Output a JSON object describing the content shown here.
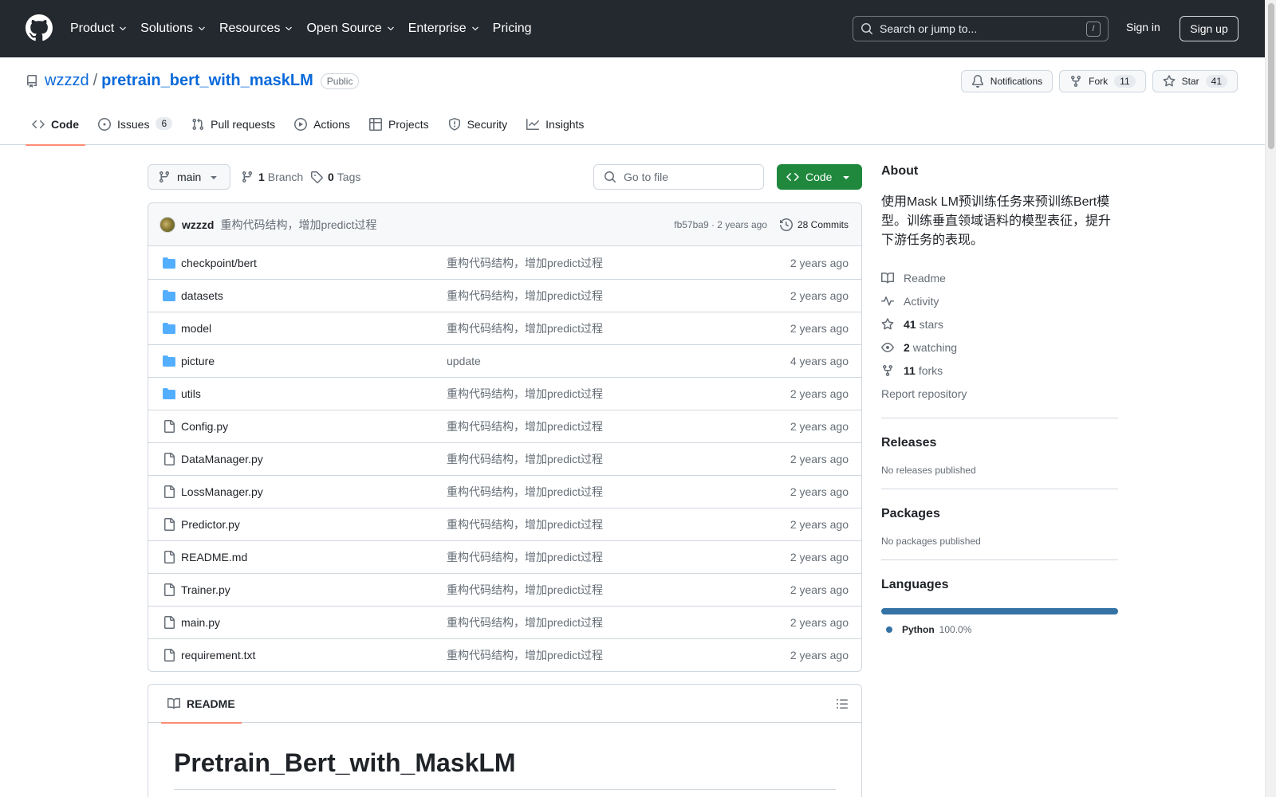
{
  "header": {
    "nav": [
      {
        "label": "Product",
        "dropdown": true
      },
      {
        "label": "Solutions",
        "dropdown": true
      },
      {
        "label": "Resources",
        "dropdown": true
      },
      {
        "label": "Open Source",
        "dropdown": true
      },
      {
        "label": "Enterprise",
        "dropdown": true
      },
      {
        "label": "Pricing",
        "dropdown": false
      }
    ],
    "search_placeholder": "Search or jump to...",
    "search_shortcut": "/",
    "sign_in": "Sign in",
    "sign_up": "Sign up"
  },
  "repo": {
    "owner": "wzzzd",
    "separator": "/",
    "name": "pretrain_bert_with_maskLM",
    "visibility": "Public",
    "notifications_label": "Notifications",
    "fork_label": "Fork",
    "fork_count": "11",
    "star_label": "Star",
    "star_count": "41"
  },
  "tabs": [
    {
      "label": "Code",
      "icon": "code-icon",
      "active": true,
      "count": ""
    },
    {
      "label": "Issues",
      "icon": "issue-opened-icon",
      "active": false,
      "count": "6"
    },
    {
      "label": "Pull requests",
      "icon": "git-pull-request-icon",
      "active": false,
      "count": ""
    },
    {
      "label": "Actions",
      "icon": "play-icon",
      "active": false,
      "count": ""
    },
    {
      "label": "Projects",
      "icon": "table-icon",
      "active": false,
      "count": ""
    },
    {
      "label": "Security",
      "icon": "shield-icon",
      "active": false,
      "count": ""
    },
    {
      "label": "Insights",
      "icon": "graph-icon",
      "active": false,
      "count": ""
    }
  ],
  "toolbar": {
    "branch": "main",
    "branch_count": "1",
    "branch_label": "Branch",
    "tag_count": "0",
    "tag_label": "Tags",
    "goto_placeholder": "Go to file",
    "code_button": "Code"
  },
  "latest_commit": {
    "author": "wzzzd",
    "message": "重构代码结构，增加predict过程",
    "hash_age": "fb57ba9 · 2 years ago",
    "commits": "28 Commits"
  },
  "files": [
    {
      "type": "dir",
      "name": "checkpoint/bert",
      "message": "重构代码结构，增加predict过程",
      "age": "2 years ago"
    },
    {
      "type": "dir",
      "name": "datasets",
      "message": "重构代码结构，增加predict过程",
      "age": "2 years ago"
    },
    {
      "type": "dir",
      "name": "model",
      "message": "重构代码结构，增加predict过程",
      "age": "2 years ago"
    },
    {
      "type": "dir",
      "name": "picture",
      "message": "update",
      "age": "4 years ago"
    },
    {
      "type": "dir",
      "name": "utils",
      "message": "重构代码结构，增加predict过程",
      "age": "2 years ago"
    },
    {
      "type": "file",
      "name": "Config.py",
      "message": "重构代码结构，增加predict过程",
      "age": "2 years ago"
    },
    {
      "type": "file",
      "name": "DataManager.py",
      "message": "重构代码结构，增加predict过程",
      "age": "2 years ago"
    },
    {
      "type": "file",
      "name": "LossManager.py",
      "message": "重构代码结构，增加predict过程",
      "age": "2 years ago"
    },
    {
      "type": "file",
      "name": "Predictor.py",
      "message": "重构代码结构，增加predict过程",
      "age": "2 years ago"
    },
    {
      "type": "file",
      "name": "README.md",
      "message": "重构代码结构，增加predict过程",
      "age": "2 years ago"
    },
    {
      "type": "file",
      "name": "Trainer.py",
      "message": "重构代码结构，增加predict过程",
      "age": "2 years ago"
    },
    {
      "type": "file",
      "name": "main.py",
      "message": "重构代码结构，增加predict过程",
      "age": "2 years ago"
    },
    {
      "type": "file",
      "name": "requirement.txt",
      "message": "重构代码结构，增加predict过程",
      "age": "2 years ago"
    }
  ],
  "readme": {
    "tab_label": "README",
    "heading": "Pretrain_Bert_with_MaskLM"
  },
  "sidebar": {
    "about_title": "About",
    "about_text": "使用Mask LM预训练任务来预训练Bert模型。训练垂直领域语料的模型表征，提升下游任务的表现。",
    "links": [
      {
        "icon": "book-icon",
        "count": "",
        "label": "Readme"
      },
      {
        "icon": "pulse-icon",
        "count": "",
        "label": "Activity"
      },
      {
        "icon": "star-icon",
        "count": "41",
        "label": "stars"
      },
      {
        "icon": "eye-icon",
        "count": "2",
        "label": "watching"
      },
      {
        "icon": "repo-forked-icon",
        "count": "11",
        "label": "forks"
      }
    ],
    "report": "Report repository",
    "releases_title": "Releases",
    "releases_text": "No releases published",
    "packages_title": "Packages",
    "packages_text": "No packages published",
    "languages_title": "Languages",
    "languages": [
      {
        "name": "Python",
        "percent": "100.0%",
        "color": "#3572A5",
        "share": 1.0
      }
    ]
  },
  "colors": {
    "header_bg": "#24292f",
    "link": "#0969da",
    "primary_button": "#1f883d",
    "active_tab_underline": "#fd8c73",
    "folder": "#54aeff"
  }
}
